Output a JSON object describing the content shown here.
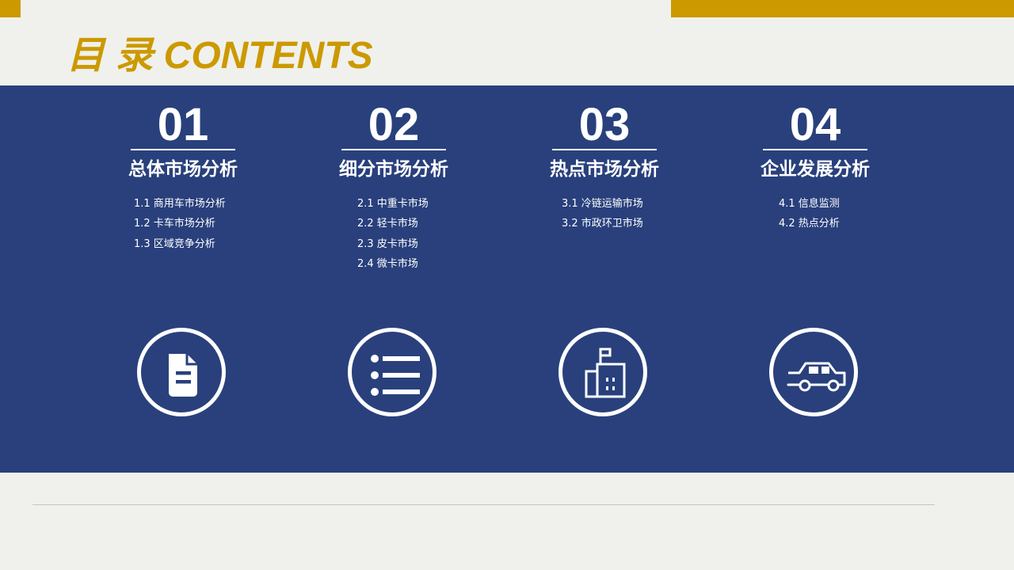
{
  "colors": {
    "accent": "#cc9900",
    "band": "#29407c",
    "background": "#f0f1ec"
  },
  "title": "目 录 CONTENTS",
  "sections": [
    {
      "number": "01",
      "heading": "总体市场分析",
      "icon": "document-icon",
      "items": [
        "1.1 商用车市场分析",
        "1.2 卡车市场分析",
        "1.3 区域竞争分析"
      ]
    },
    {
      "number": "02",
      "heading": "细分市场分析",
      "icon": "list-icon",
      "items": [
        "2.1 中重卡市场",
        "2.2 轻卡市场",
        "2.3 皮卡市场",
        "2.4 微卡市场"
      ]
    },
    {
      "number": "03",
      "heading": "热点市场分析",
      "icon": "building-icon",
      "items": [
        "3.1 冷链运输市场",
        "3.2 市政环卫市场"
      ]
    },
    {
      "number": "04",
      "heading": "企业发展分析",
      "icon": "car-icon",
      "items": [
        "4.1 信息监测",
        "4.2 热点分析"
      ]
    }
  ]
}
